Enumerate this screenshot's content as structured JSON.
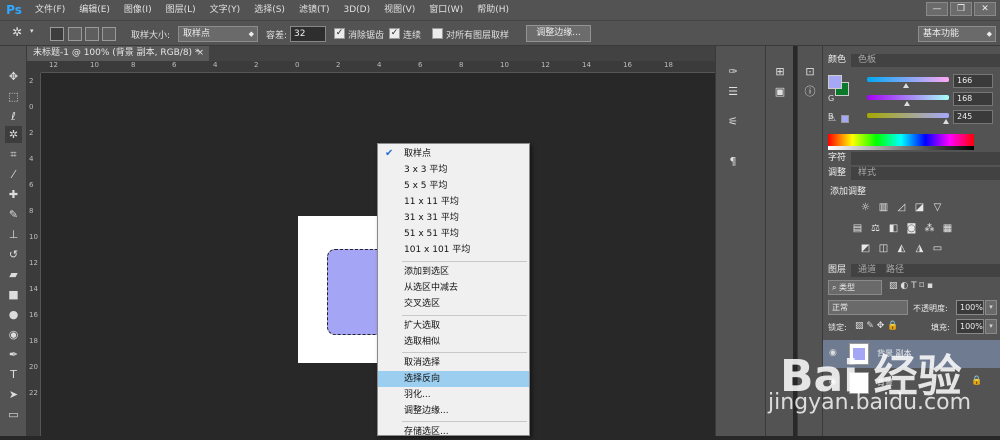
{
  "menubar": {
    "logo": "Ps",
    "items": [
      "文件(F)",
      "编辑(E)",
      "图像(I)",
      "图层(L)",
      "文字(Y)",
      "选择(S)",
      "滤镜(T)",
      "3D(D)",
      "视图(V)",
      "窗口(W)",
      "帮助(H)"
    ],
    "win_min": "—",
    "win_restore": "❐",
    "win_close": "✕"
  },
  "options": {
    "sample_size_label": "取样大小:",
    "sample_size_value": "取样点",
    "tolerance_label": "容差:",
    "tolerance_value": "32",
    "antialias_label": "消除锯齿",
    "contiguous_label": "连续",
    "all_layers_label": "对所有图层取样",
    "refine_edge_button": "调整边缘...",
    "workspace_value": "基本功能"
  },
  "document": {
    "tab_title": "未标题-1 @ 100% (背景 副本, RGB/8) *",
    "close_glyph": "×",
    "selection_fill": "#a5a5f5"
  },
  "rulers": {
    "top_ticks": [
      "12",
      "10",
      "8",
      "6",
      "4",
      "2",
      "0",
      "2",
      "4",
      "6",
      "8",
      "10",
      "12",
      "14",
      "16",
      "18"
    ],
    "left_ticks": [
      "2",
      "0",
      "2",
      "4",
      "6",
      "8",
      "10",
      "12",
      "14",
      "16",
      "18",
      "20",
      "22"
    ]
  },
  "context_menu": {
    "items": [
      {
        "label": "取样点",
        "checked": true
      },
      {
        "label": "3 x 3 平均"
      },
      {
        "label": "5 x 5 平均"
      },
      {
        "label": "11 x 11 平均"
      },
      {
        "label": "31 x 31 平均"
      },
      {
        "label": "51 x 51 平均"
      },
      {
        "label": "101 x 101 平均"
      },
      {
        "label": "添加到选区"
      },
      {
        "label": "从选区中减去"
      },
      {
        "label": "交叉选区"
      },
      {
        "label": "扩大选取"
      },
      {
        "label": "选取相似"
      },
      {
        "label": "取消选择"
      },
      {
        "label": "选择反向",
        "highlighted": true
      },
      {
        "label": "羽化..."
      },
      {
        "label": "调整边缘..."
      },
      {
        "label": "存储选区..."
      }
    ]
  },
  "color_panel": {
    "tab_color": "颜色",
    "tab_swatches": "色板",
    "r_label": "R",
    "g_label": "G",
    "b_label": "B",
    "r_value": "166",
    "g_value": "168",
    "b_value": "245",
    "foreground": "#a6a8f5",
    "background": "#0a7a2a"
  },
  "char_panel": {
    "tab_character": "字符"
  },
  "adjust_panel": {
    "tab_adjustments": "调整",
    "tab_styles": "样式",
    "heading": "添加调整"
  },
  "layers_panel": {
    "tab_layers": "图层",
    "tab_channels": "通道",
    "tab_paths": "路径",
    "filter_kind": "类型",
    "blend_mode": "正常",
    "opacity_label": "不透明度:",
    "opacity_value": "100%",
    "lock_label": "锁定:",
    "fill_label": "填充:",
    "fill_value": "100%",
    "layers": [
      {
        "name": "背景 副本"
      },
      {
        "name": "背景"
      }
    ]
  },
  "watermark": {
    "logo": "Bai 经验",
    "url": "jingyan.baidu.com"
  }
}
